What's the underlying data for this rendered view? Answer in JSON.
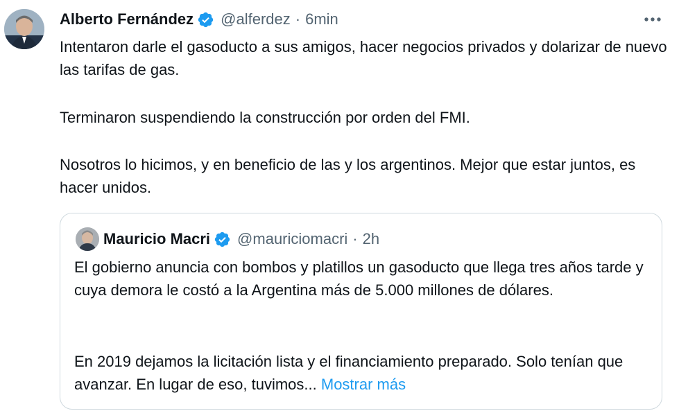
{
  "tweet": {
    "author_name": "Alberto Fernández",
    "handle": "@alferdez",
    "separator": "·",
    "time": "6min",
    "avatar_icon": "person-avatar",
    "verified_icon": "verified-badge-icon",
    "more_icon": "more-options-icon",
    "paragraphs": [
      "Intentaron darle el gasoducto a sus amigos, hacer negocios privados y dolarizar de nuevo las tarifas de gas.",
      "Terminaron suspendiendo la construcción por orden del FMI.",
      "Nosotros lo hicimos, y en beneficio de las y los argentinos. Mejor que estar juntos, es hacer unidos."
    ]
  },
  "quoted_tweet": {
    "author_name": "Mauricio Macri",
    "handle": "@mauriciomacri",
    "separator": "·",
    "time": "2h",
    "avatar_icon": "person-avatar",
    "verified_icon": "verified-badge-icon",
    "paragraphs": [
      "El gobierno anuncia con bombos y platillos un gasoducto que llega tres años tarde y cuya demora le costó a la Argentina más de 5.000 millones de dólares.",
      "En 2019 dejamos la licitación lista y el financiamiento preparado. Solo tenían que avanzar. En lugar de eso, tuvimos..."
    ],
    "show_more": "Mostrar más"
  },
  "colors": {
    "text": "#0f1419",
    "secondary": "#536471",
    "link": "#1d9bf0",
    "verified": "#1d9bf0",
    "border": "#cfd9de"
  }
}
